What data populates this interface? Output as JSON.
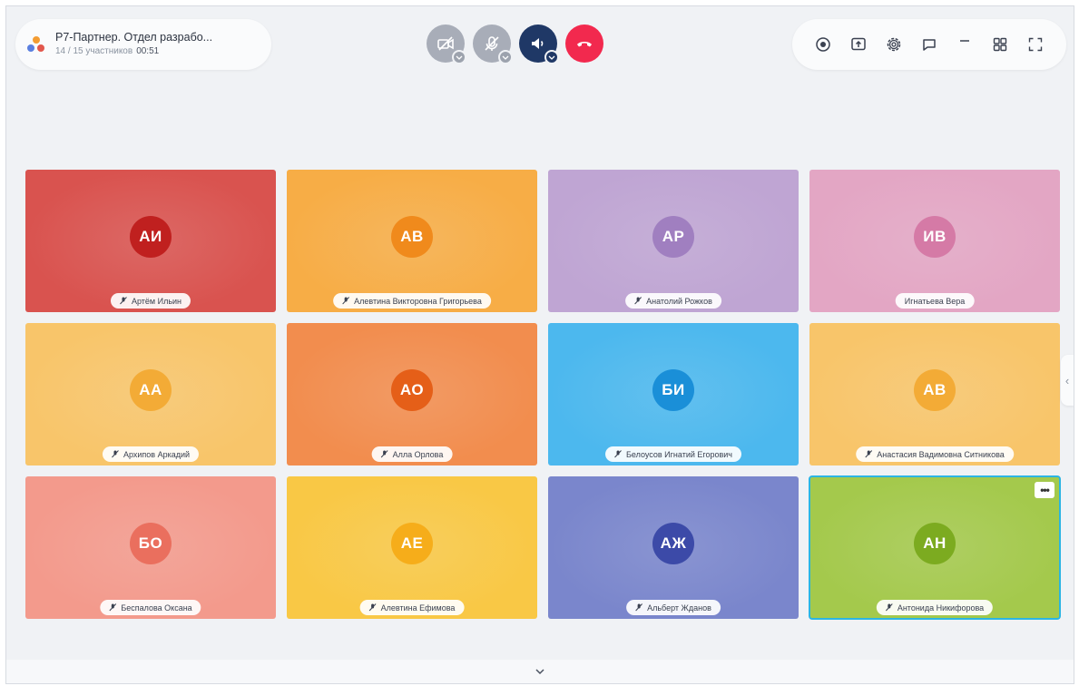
{
  "conference": {
    "title": "Р7-Партнер. Отдел разрабо...",
    "participants": "14 / 15 участников",
    "timer": "00:51"
  },
  "controls": [
    {
      "name": "camera-button",
      "icon": "camera-off-icon",
      "state": "off",
      "color": "#a8adb8"
    },
    {
      "name": "microphone-button",
      "icon": "mic-off-icon",
      "state": "off",
      "color": "#a8adb8"
    },
    {
      "name": "speaker-button",
      "icon": "speaker-icon",
      "state": "on",
      "color": "#1f3866"
    },
    {
      "name": "hangup-button",
      "icon": "phone-hangup-icon",
      "state": "danger",
      "color": "#f2294e"
    }
  ],
  "toolbar": [
    {
      "name": "record-button",
      "icon": "record-icon"
    },
    {
      "name": "share-screen-button",
      "icon": "share-screen-icon"
    },
    {
      "name": "settings-button",
      "icon": "gear-icon"
    },
    {
      "name": "chat-button",
      "icon": "chat-icon"
    },
    {
      "name": "minimize-button",
      "icon": "minimize-icon"
    },
    {
      "name": "layout-button",
      "icon": "grid-layout-icon"
    },
    {
      "name": "fullscreen-button",
      "icon": "fullscreen-icon"
    }
  ],
  "participants": [
    {
      "initials": "АИ",
      "name": "Артём Ильин",
      "muted": true,
      "bg": "#d9534f",
      "avatar": "#c0201f"
    },
    {
      "initials": "АВ",
      "name": "Алевтина Викторовна Григорьева",
      "muted": true,
      "bg": "#f7ad46",
      "avatar": "#f08a1c"
    },
    {
      "initials": "АР",
      "name": "Анатолий Рожков",
      "muted": true,
      "bg": "#bfa5d3",
      "avatar": "#a07fc0"
    },
    {
      "initials": "ИВ",
      "name": "Игнатьева Вера",
      "muted": false,
      "bg": "#e3a6c4",
      "avatar": "#d57aa6"
    },
    {
      "initials": "АА",
      "name": "Архипов Аркадий",
      "muted": true,
      "bg": "#f8c56a",
      "avatar": "#f3ab36"
    },
    {
      "initials": "АО",
      "name": "Алла Орлова",
      "muted": true,
      "bg": "#f28d4e",
      "avatar": "#e55f18"
    },
    {
      "initials": "БИ",
      "name": "Белоусов Игнатий Егорович",
      "muted": true,
      "bg": "#4cb8ee",
      "avatar": "#1a8fd8"
    },
    {
      "initials": "АВ",
      "name": "Анастасия Вадимовна Ситникова",
      "muted": true,
      "bg": "#f8c56a",
      "avatar": "#f3ab36"
    },
    {
      "initials": "БО",
      "name": "Беспалова Оксана",
      "muted": true,
      "bg": "#f39a8c",
      "avatar": "#ea6f5e"
    },
    {
      "initials": "АЕ",
      "name": "Алевтина Ефимова",
      "muted": true,
      "bg": "#f9c845",
      "avatar": "#f6ad1a"
    },
    {
      "initials": "АЖ",
      "name": "Альберт Жданов",
      "muted": true,
      "bg": "#7a86cc",
      "avatar": "#3c4aa8"
    },
    {
      "initials": "АН",
      "name": "Антонида Никифорова",
      "muted": true,
      "bg": "#a4c94c",
      "avatar": "#7cab20",
      "active": true
    }
  ],
  "more_label": "•••",
  "side_handle_label": "‹",
  "bottom_label": "⌄"
}
